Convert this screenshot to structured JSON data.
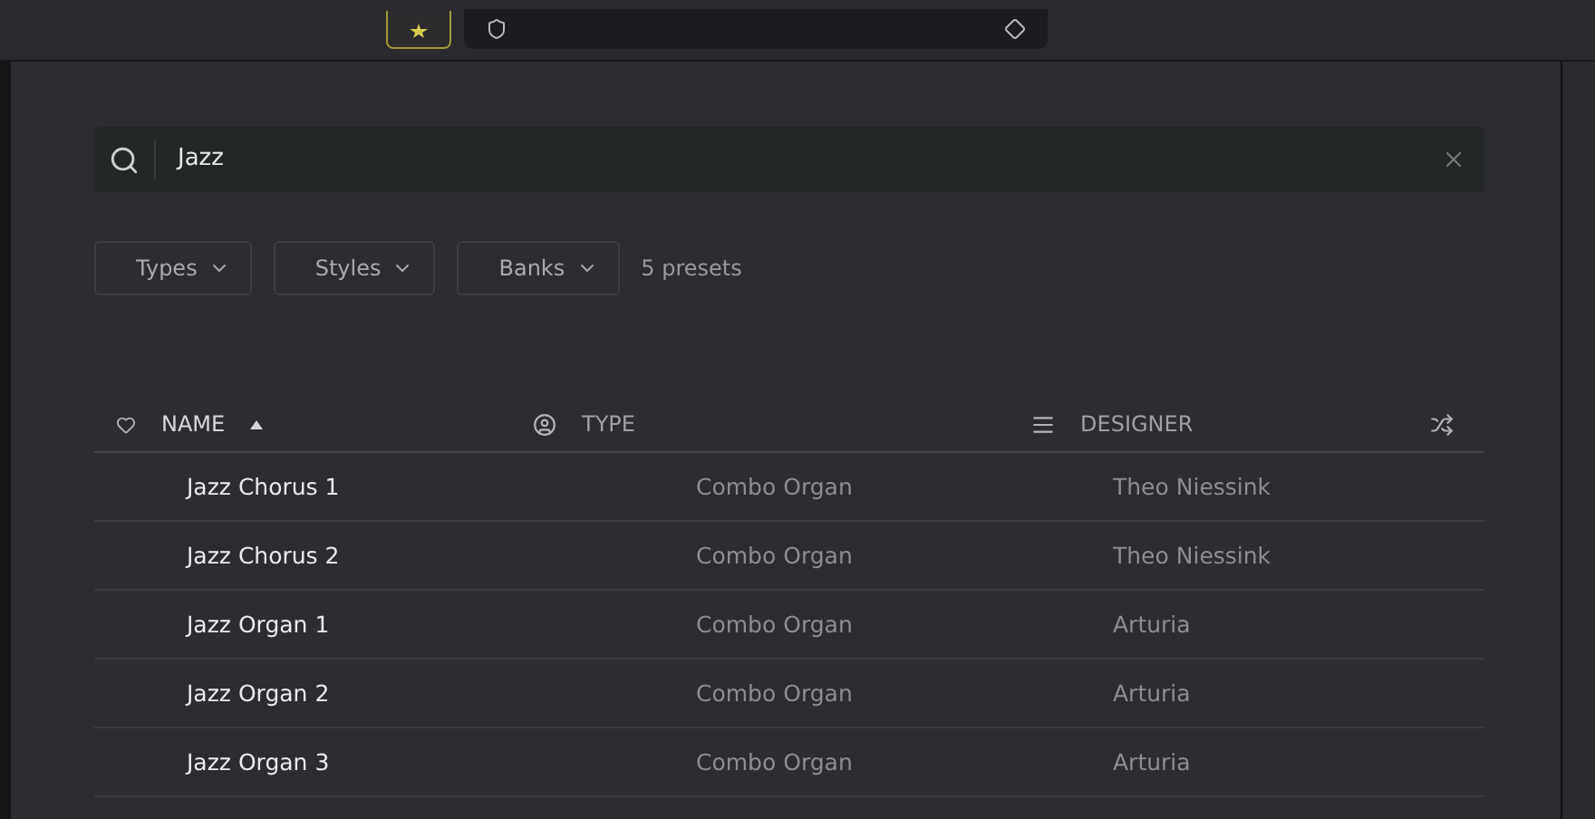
{
  "search": {
    "value": "Jazz"
  },
  "filters": [
    {
      "label": "Types"
    },
    {
      "label": "Styles"
    },
    {
      "label": "Banks"
    }
  ],
  "result_count": "5 presets",
  "table": {
    "columns": [
      {
        "label": "NAME",
        "sorted": true
      },
      {
        "label": "TYPE",
        "sorted": false
      },
      {
        "label": "DESIGNER",
        "sorted": false
      }
    ],
    "rows": [
      {
        "name": "Jazz Chorus 1",
        "type": "Combo Organ",
        "designer": "Theo Niessink"
      },
      {
        "name": "Jazz Chorus 2",
        "type": "Combo Organ",
        "designer": "Theo Niessink"
      },
      {
        "name": "Jazz Organ 1",
        "type": "Combo Organ",
        "designer": "Arturia"
      },
      {
        "name": "Jazz Organ 2",
        "type": "Combo Organ",
        "designer": "Arturia"
      },
      {
        "name": "Jazz Organ 3",
        "type": "Combo Organ",
        "designer": "Arturia"
      }
    ]
  }
}
